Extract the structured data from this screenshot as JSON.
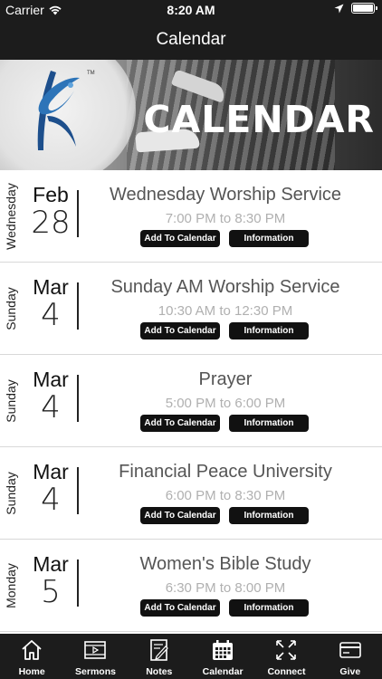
{
  "status_bar": {
    "carrier": "Carrier",
    "time": "8:20 AM"
  },
  "nav": {
    "title": "Calendar"
  },
  "banner": {
    "title": "CALENDAR",
    "logo_mark": "TM"
  },
  "events": [
    {
      "weekday": "Wednesday",
      "month": "Feb",
      "day": "28",
      "name": "Wednesday Worship Service",
      "time": "7:00 PM to 8:30 PM",
      "add_label": "Add To Calendar",
      "info_label": "Information"
    },
    {
      "weekday": "Sunday",
      "month": "Mar",
      "day": "4",
      "name": "Sunday AM Worship Service",
      "time": "10:30 AM to 12:30 PM",
      "add_label": "Add To Calendar",
      "info_label": "Information"
    },
    {
      "weekday": "Sunday",
      "month": "Mar",
      "day": "4",
      "name": "Prayer",
      "time": "5:00 PM to 6:00 PM",
      "add_label": "Add To Calendar",
      "info_label": "Information"
    },
    {
      "weekday": "Sunday",
      "month": "Mar",
      "day": "4",
      "name": "Financial Peace University",
      "time": "6:00 PM to 8:30 PM",
      "add_label": "Add To Calendar",
      "info_label": "Information"
    },
    {
      "weekday": "Monday",
      "month": "Mar",
      "day": "5",
      "name": "Women's Bible Study",
      "time": "6:30 PM to 8:00 PM",
      "add_label": "Add To Calendar",
      "info_label": "Information"
    }
  ],
  "tabs": [
    {
      "label": "Home",
      "icon": "home-icon"
    },
    {
      "label": "Sermons",
      "icon": "video-icon"
    },
    {
      "label": "Notes",
      "icon": "notes-icon"
    },
    {
      "label": "Calendar",
      "icon": "calendar-icon"
    },
    {
      "label": "Connect",
      "icon": "connect-icon"
    },
    {
      "label": "Give",
      "icon": "card-icon"
    }
  ],
  "colors": {
    "bar_background": "#1c1c1c",
    "button_background": "#111111",
    "time_text": "#b0b0b0"
  }
}
